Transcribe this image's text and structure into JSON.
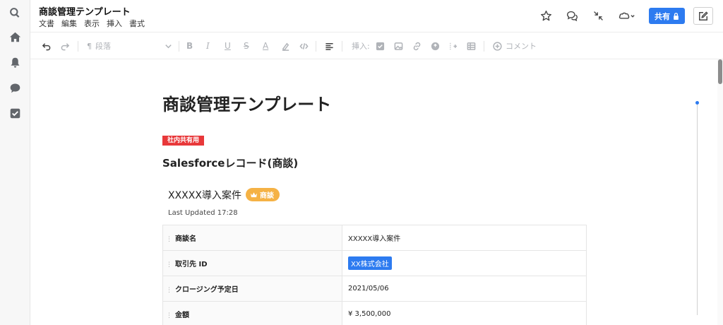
{
  "header": {
    "title": "商談管理テンプレート",
    "menu": [
      "文書",
      "編集",
      "表示",
      "挿入",
      "書式"
    ],
    "share_label": "共有"
  },
  "toolbar": {
    "paragraph_label": "段落",
    "insert_label": "挿入:",
    "comment_label": "コメント"
  },
  "document": {
    "heading": "商談管理テンプレート",
    "tag": "社内共有用",
    "subheading": "Salesforceレコード(商談)",
    "record": {
      "title": "XXXXX導入案件",
      "badge": "商談",
      "updated": "Last Updated 17:28",
      "rows": [
        {
          "key": "商談名",
          "value": "XXXXX導入案件"
        },
        {
          "key": "取引先 ID",
          "value": "XX株式会社"
        },
        {
          "key": "クロージング予定日",
          "value": "2021/05/06"
        },
        {
          "key": "金額",
          "value": "¥ 3,500,000"
        }
      ]
    }
  },
  "colors": {
    "accent": "#2d7bf0",
    "tag_red": "#e8383a",
    "badge_orange": "#f5b245"
  },
  "icons": {
    "rail": [
      "search-icon",
      "home-icon",
      "bell-icon",
      "chat-icon",
      "checkbox-icon"
    ]
  }
}
